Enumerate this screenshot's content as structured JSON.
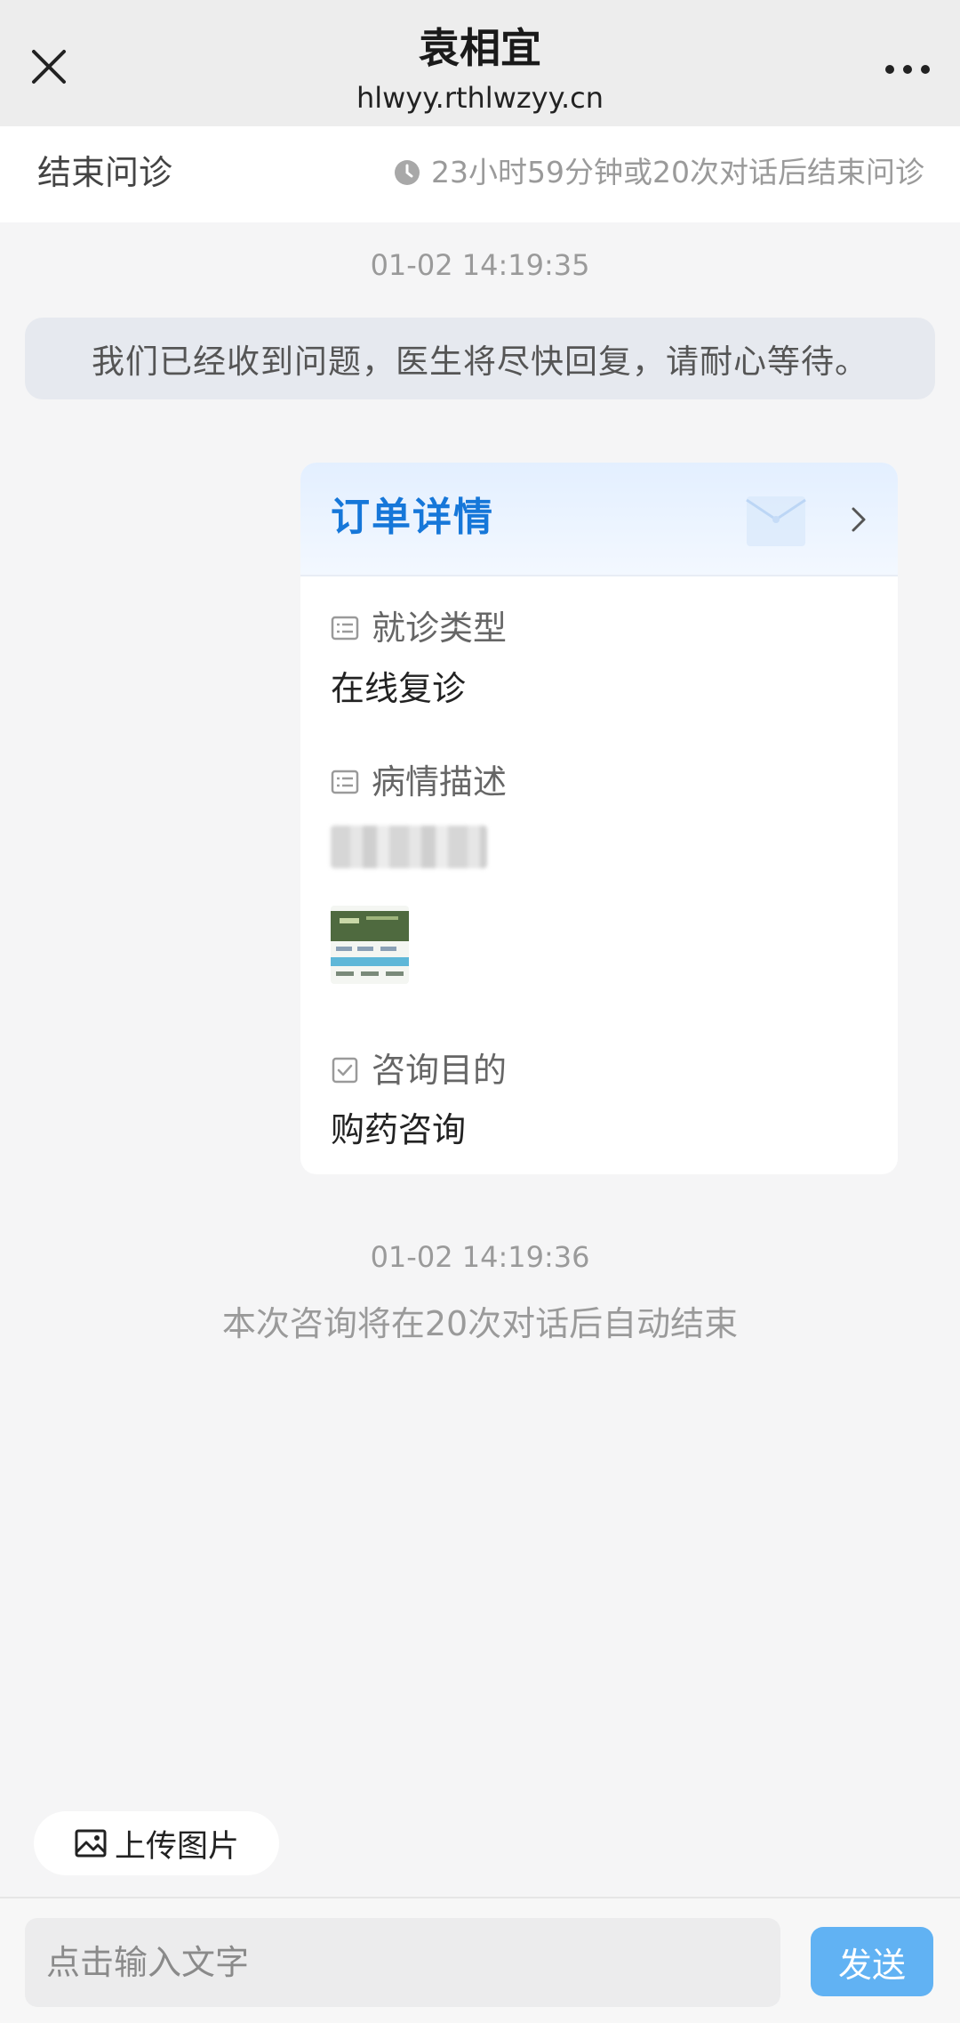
{
  "header": {
    "title": "袁相宜",
    "domain": "hlwyy.rthlwzyy.cn",
    "close_icon": "close-icon",
    "more_icon": "more-icon"
  },
  "status_bar": {
    "end_label": "结束问诊",
    "countdown_text": "23小时59分钟或20次对话后结束问诊",
    "clock_icon": "clock-icon"
  },
  "chat": {
    "timestamp_1": "01-02 14:19:35",
    "system_message": "我们已经收到问题，医生将尽快回复，请耐心等待。",
    "timestamp_2": "01-02 14:19:36",
    "auto_end_notice": "本次咨询将在20次对话后自动结束"
  },
  "order_card": {
    "title": "订单详情",
    "visit_type_label": "就诊类型",
    "visit_type_value": "在线复诊",
    "condition_label": "病情描述",
    "purpose_label": "咨询目的",
    "purpose_value": "购药咨询"
  },
  "composer": {
    "upload_label": "上传图片",
    "input_placeholder": "点击输入文字",
    "send_label": "发送"
  },
  "colors": {
    "accent": "#1677d9",
    "send_button": "#61b2f3",
    "muted_text": "#9a9a9a"
  }
}
